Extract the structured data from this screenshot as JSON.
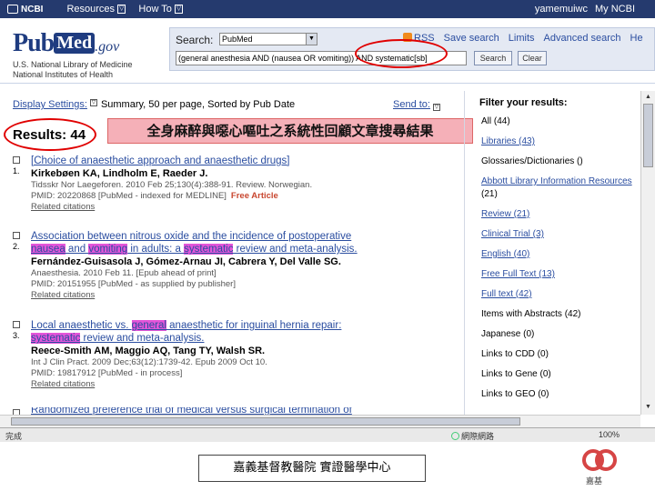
{
  "topbar": {
    "logo": "NCBI",
    "resources": "Resources",
    "howto": "How To",
    "dd": "▽",
    "username": "yamemuiwc",
    "myncbi": "My NCBI"
  },
  "header": {
    "pub": "Pub",
    "med": "Med",
    "gov": ".gov",
    "nlm_line1": "U.S. National Library of Medicine",
    "nlm_line2": "National Institutes of Health"
  },
  "search": {
    "label": "Search:",
    "db": "PubMed",
    "links": [
      "RSS",
      "Save search",
      "Limits",
      "Advanced search",
      "He"
    ],
    "query": "(general anesthesia AND (nausea OR vomiting)) AND systematic[sb]",
    "search_button": "Search",
    "clear_button": "Clear"
  },
  "display": {
    "settings": "Display Settings:",
    "summary": "Summary, 50 per page, Sorted by Pub Date",
    "sendto": "Send to:"
  },
  "results_count": "Results: 44",
  "banner": "全身麻醉與噁心嘔吐之系統性回顧文章搜尋結果",
  "results": [
    {
      "num": "1.",
      "title": "[Choice of anaesthetic approach and anaesthetic drugs]",
      "authors": "Kirkebøen KA, Lindholm E, Raeder J.",
      "source": "Tidsskr Nor Laegeforen. 2010 Feb 25;130(4):388-91. Review. Norwegian.",
      "pmid": "PMID: 20220868 [PubMed - indexed for MEDLINE]",
      "free": "Free Article",
      "related": "Related citations"
    },
    {
      "num": "2.",
      "title_a": "Association between nitrous oxide and the incidence of postoperative",
      "title_b1": "nausea",
      "title_b2": " and ",
      "title_b3": "vomiting",
      "title_b4": " in adults: a ",
      "title_b5": "systematic",
      "title_b6": " review and meta-analysis.",
      "authors": "Fernández-Guisasola J, Gómez-Arnau JI, Cabrera Y, Del Valle SG.",
      "source": "Anaesthesia. 2010 Feb 11. [Epub ahead of print]",
      "pmid": "PMID: 20151955 [PubMed - as supplied by publisher]",
      "related": "Related citations"
    },
    {
      "num": "3.",
      "title_a1": "Local anaesthetic vs. ",
      "title_a2": "general",
      "title_a3": " anaesthetic for inguinal hernia repair:",
      "title_b1": "systematic",
      "title_b2": " review and meta-analysis.",
      "authors": "Reece-Smith AM, Maggio AQ, Tang TY, Walsh SR.",
      "source": "Int J Clin Pract. 2009 Dec;63(12):1739-42. Epub 2009 Oct 10.",
      "pmid": "PMID: 19817912 [PubMed - in process]",
      "related": "Related citations"
    },
    {
      "title_partial": "Randomized preference trial of medical versus surgical termination of"
    }
  ],
  "filters": {
    "heading": "Filter your results:",
    "items": [
      {
        "label": "All (44)",
        "link": false
      },
      {
        "label": "Libraries (43)",
        "link": true
      },
      {
        "label": "Glossaries/Dictionaries ()",
        "link": false
      },
      {
        "label": "Abbott Library Information Resources",
        "link": true
      },
      {
        "label": "(21)",
        "link": false
      },
      {
        "label": "Review (21)",
        "link": true
      },
      {
        "label": "Clinical Trial (3)",
        "link": true
      },
      {
        "label": "English (40)",
        "link": true
      },
      {
        "label": "Free Full Text (13)",
        "link": true
      },
      {
        "label": "Full text (42)",
        "link": true
      },
      {
        "label": "Items with Abstracts (42)",
        "link": false
      },
      {
        "label": "Japanese (0)",
        "link": false
      },
      {
        "label": "Links to CDD (0)",
        "link": false
      },
      {
        "label": "Links to Gene (0)",
        "link": false
      },
      {
        "label": "Links to GEO (0)",
        "link": false
      }
    ]
  },
  "statusbar": {
    "left": "完成",
    "zone": "網際網路",
    "zoom": "100%"
  },
  "footer": {
    "label": "嘉義基督教醫院 實證醫學中心",
    "logo_caption": "嘉基"
  },
  "colors": {
    "accent": "#253a6e",
    "link": "#2a4da0",
    "highlight": "#e455d9",
    "annotation": "#e00000",
    "banner": "#f5b0b8"
  }
}
